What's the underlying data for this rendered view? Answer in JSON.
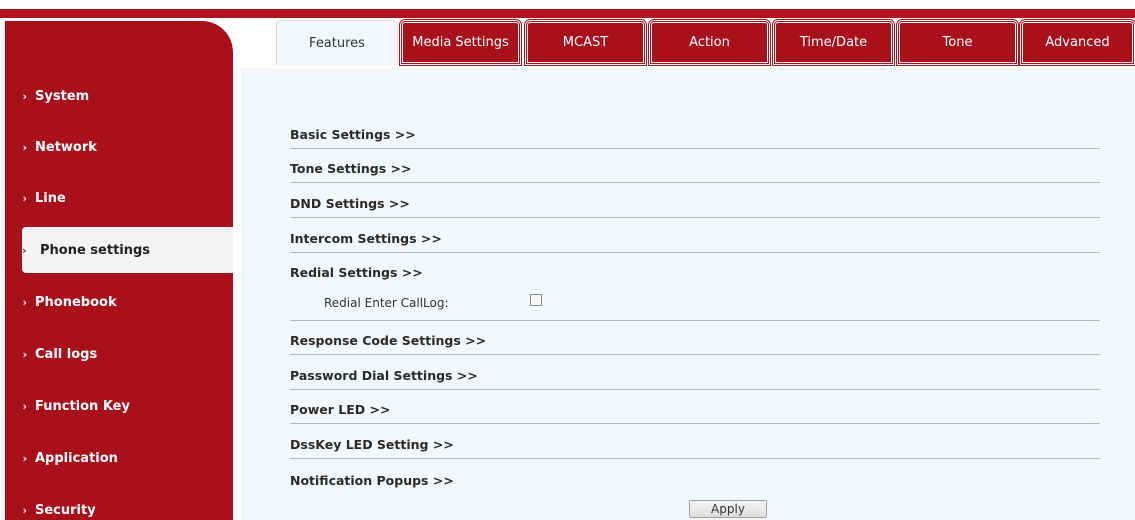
{
  "sidebar": {
    "items": [
      {
        "label": "System"
      },
      {
        "label": "Network"
      },
      {
        "label": "Line"
      },
      {
        "label": "Phone settings"
      },
      {
        "label": "Phonebook"
      },
      {
        "label": "Call logs"
      },
      {
        "label": "Function Key"
      },
      {
        "label": "Application"
      },
      {
        "label": "Security"
      }
    ],
    "active": "Phone settings",
    "chevron": "›"
  },
  "tabs": [
    {
      "label": "Features"
    },
    {
      "label": "Media Settings"
    },
    {
      "label": "MCAST"
    },
    {
      "label": "Action"
    },
    {
      "label": "Time/Date"
    },
    {
      "label": "Tone"
    },
    {
      "label": "Advanced"
    }
  ],
  "active_tab": "Features",
  "sections": [
    {
      "label": "Basic Settings >>"
    },
    {
      "label": "Tone Settings >>"
    },
    {
      "label": "DND Settings >>"
    },
    {
      "label": "Intercom Settings >>"
    },
    {
      "label": "Redial Settings >>"
    },
    {
      "label": "Response Code Settings >>"
    },
    {
      "label": "Password Dial Settings >>"
    },
    {
      "label": "Power LED >>"
    },
    {
      "label": "DssKey LED Setting >>"
    },
    {
      "label": "Notification Popups >>"
    }
  ],
  "redial": {
    "enter_calllog_label": "Redial Enter CallLog:",
    "enter_calllog_checked": false
  },
  "apply_label": "Apply",
  "colors": {
    "brand_red": "#a8111c",
    "panel_bg": "#f3f7fa"
  }
}
